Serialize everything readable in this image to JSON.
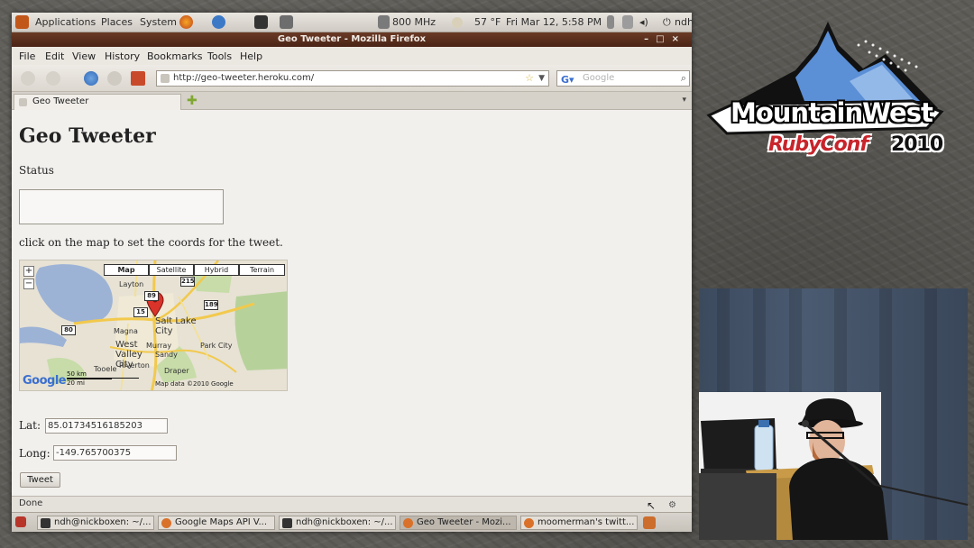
{
  "desktop_panel": {
    "applications": "Applications",
    "places": "Places",
    "system": "System",
    "cpu": "800 MHz",
    "temperature": "57 °F",
    "datetime": "Fri Mar 12, 5:58 PM",
    "user": "ndh"
  },
  "window": {
    "title": "Geo Tweeter - Mozilla Firefox"
  },
  "menu": [
    "File",
    "Edit",
    "View",
    "History",
    "Bookmarks",
    "Tools",
    "Help"
  ],
  "navigation": {
    "url": "http://geo-tweeter.heroku.com/",
    "search_placeholder": "Google"
  },
  "tab": {
    "label": "Geo Tweeter"
  },
  "page": {
    "title": "Geo Tweeter",
    "status_label": "Status",
    "status_value": "",
    "hint": "click on the map to set the coords for the tweet.",
    "lat_label": "Lat:",
    "lat_value": "85.01734516185203",
    "long_label": "Long:",
    "long_value": "-149.765700375",
    "tweet_button": "Tweet"
  },
  "map": {
    "types": [
      "Map",
      "Satellite",
      "Hybrid",
      "Terrain"
    ],
    "selected_type": "Map",
    "zoom_in": "+",
    "zoom_out": "−",
    "labels": {
      "layton": "Layton",
      "salt_lake_city": "Salt Lake City",
      "west_valley_city": "West Valley City",
      "sandy": "Sandy",
      "magna": "Magna",
      "murray": "Murray",
      "tooele": "Tooele",
      "draper": "Draper",
      "park_city": "Park City",
      "riverton": "Riverton"
    },
    "shields": [
      "89",
      "189",
      "215",
      "80",
      "15"
    ],
    "scale_km": "50 km",
    "scale_mi": "20 mi",
    "copyright": "Map data ©2010 Google",
    "google_logo": "Google"
  },
  "statusbar": {
    "text": "Done"
  },
  "taskbar": [
    {
      "label": "ndh@nickboxen: ~/...",
      "active": false
    },
    {
      "label": "Google Maps API V...",
      "active": false
    },
    {
      "label": "ndh@nickboxen: ~/...",
      "active": false
    },
    {
      "label": "Geo Tweeter - Mozi...",
      "active": true
    },
    {
      "label": "moomerman's twitt...",
      "active": false
    }
  ],
  "conference_logo": {
    "name": "MountainWest",
    "subtitle": "RubyConf",
    "year": "2010"
  },
  "colors": {
    "title_bar": "#5a2e1c",
    "logo_red": "#c8242b",
    "logo_blue": "#5b8fd6"
  }
}
